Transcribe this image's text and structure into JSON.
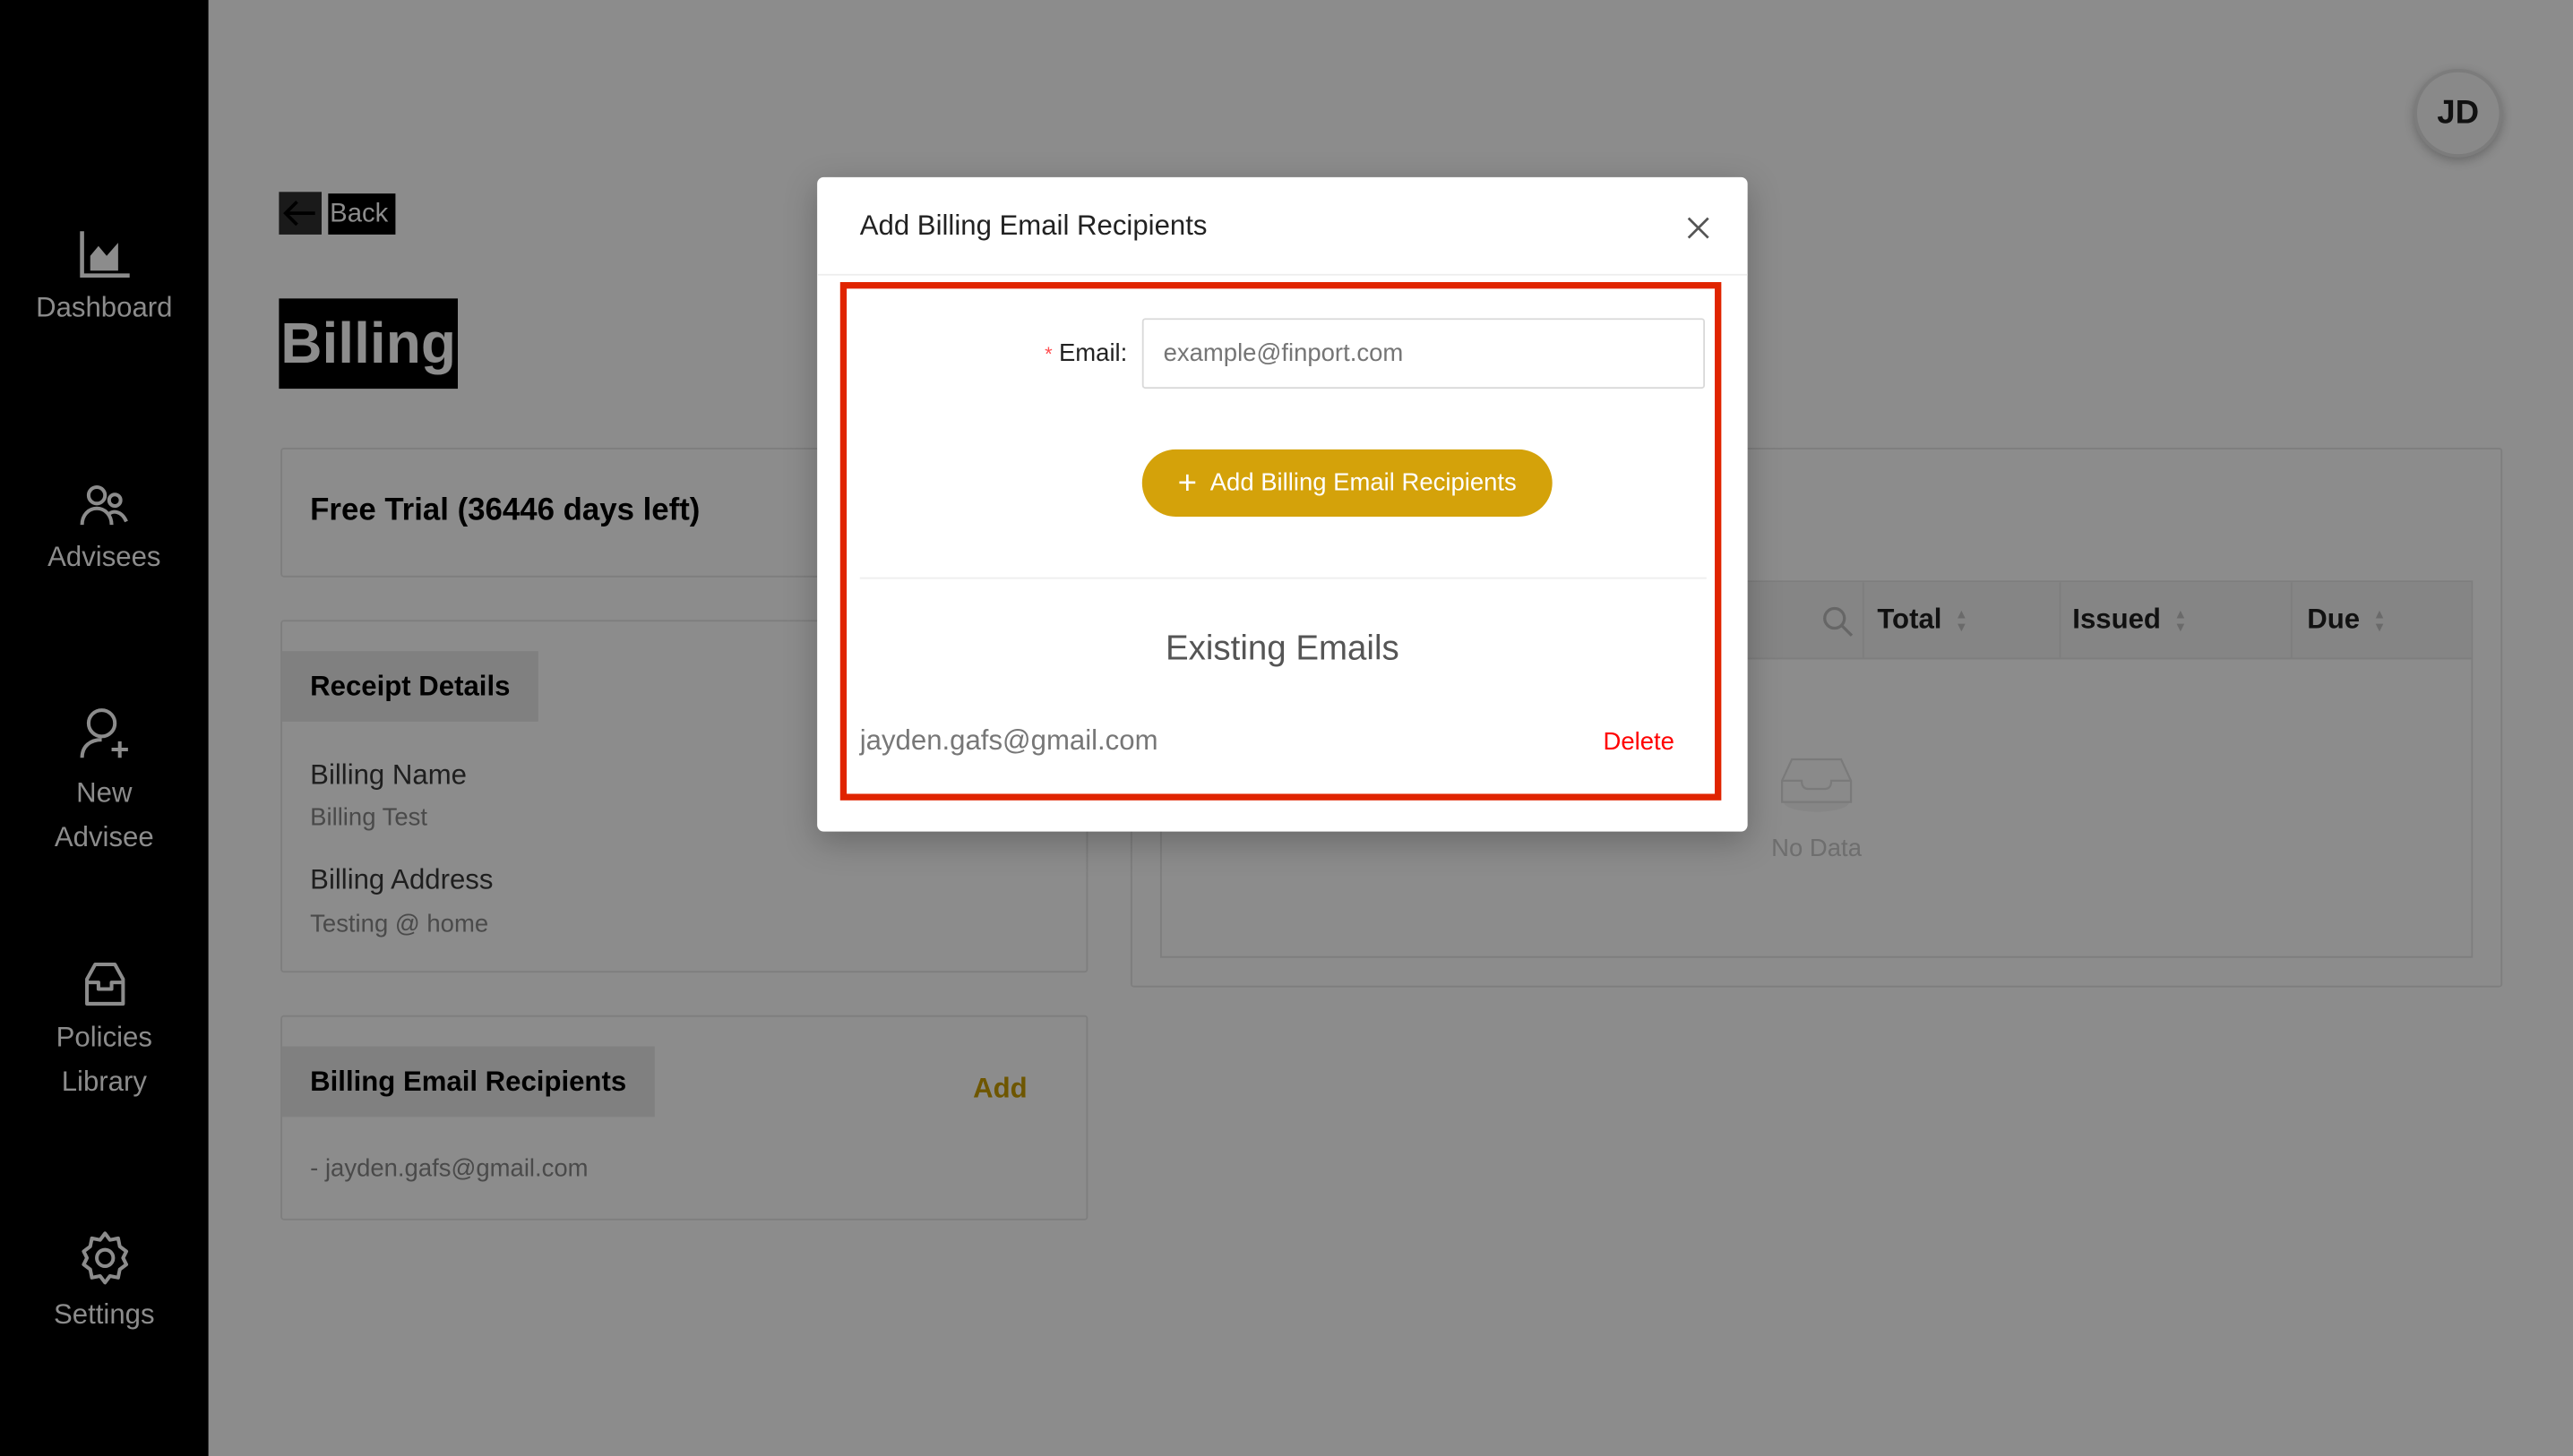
{
  "sidebar": {
    "items": [
      {
        "label": "Dashboard",
        "icon": "area-chart-icon"
      },
      {
        "label": "Advisees",
        "icon": "users-icon"
      },
      {
        "label": "New",
        "label2": "Advisee",
        "icon": "user-add-icon"
      },
      {
        "label": "Policies",
        "label2": "Library",
        "icon": "inbox-icon"
      },
      {
        "label": "Settings",
        "icon": "gear-icon"
      }
    ]
  },
  "header": {
    "avatar": "JD",
    "back": "Back",
    "title": "Billing"
  },
  "plan": {
    "title": "Free Trial (36446 days left)"
  },
  "receipt": {
    "tab": "Receipt Details",
    "name_label": "Billing Name",
    "name_value": "Billing Test",
    "address_label": "Billing Address",
    "address_value": "Testing @ home"
  },
  "recipients": {
    "tab": "Billing Email Recipients",
    "add": "Add",
    "items": [
      "- jayden.gafs@gmail.com"
    ]
  },
  "invoices": {
    "columns": [
      "Total",
      "Issued",
      "Due"
    ],
    "empty": "No Data"
  },
  "modal": {
    "title": "Add Billing Email Recipients",
    "email_label": "Email",
    "email_placeholder": "example@finport.com",
    "email_value": "",
    "add_button": "Add Billing Email Recipients",
    "existing_title": "Existing Emails",
    "existing": [
      {
        "email": "jayden.gafs@gmail.com",
        "action": "Delete"
      }
    ]
  },
  "colors": {
    "accent": "#d4a20a",
    "danger": "#ff0000",
    "highlight": "#e02400"
  }
}
